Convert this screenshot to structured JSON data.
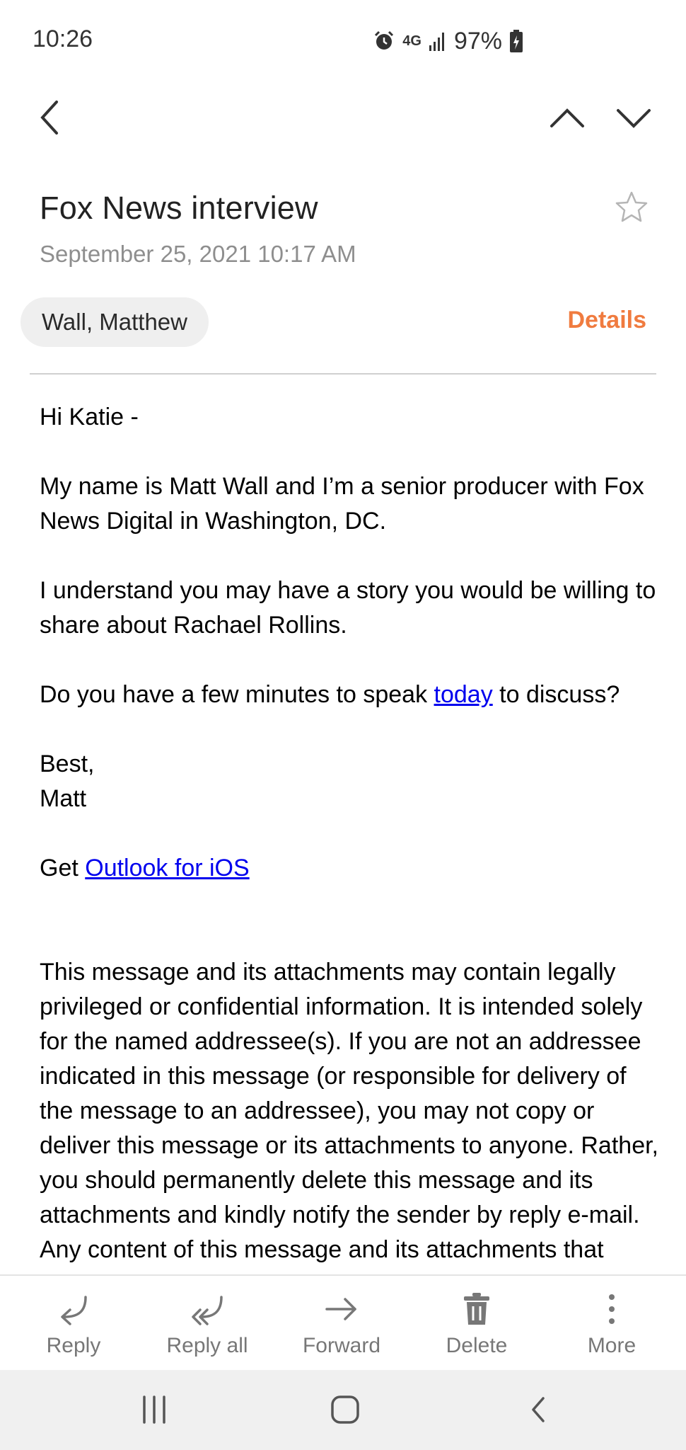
{
  "status_bar": {
    "time": "10:26",
    "network": "4G",
    "battery": "97%"
  },
  "icons": {
    "alarm": "alarm-icon",
    "signal": "signal-icon",
    "battery": "battery-charging-icon",
    "back": "chevron-left-icon",
    "prev": "chevron-up-icon",
    "next": "chevron-down-icon",
    "star": "star-outline-icon",
    "reply": "reply-icon",
    "reply_all": "reply-all-icon",
    "forward": "forward-icon",
    "delete": "trash-icon",
    "more": "more-vertical-icon"
  },
  "email": {
    "subject": "Fox News interview",
    "date": "September 25, 2021  10:17 AM",
    "sender": "Wall, Matthew",
    "details_label": "Details",
    "body": {
      "greeting": "Hi Katie -",
      "para1": "My name is Matt Wall and I’m a senior producer with Fox News Digital in Washington, DC.",
      "para2": "I understand you may have a story you would be willing to share about Rachael Rollins.",
      "para3_before": "Do you have a few minutes to speak ",
      "para3_link": "today",
      "para3_after": " to discuss?",
      "signoff": "Best,",
      "signature": "Matt",
      "get_prefix": "Get ",
      "get_link": "Outlook for iOS",
      "disclaimer": "This message and its attachments may contain legally privileged or confidential information. It is intended solely for the named addressee(s). If you are not an addressee indicated in this message (or responsible for delivery of the message to an addressee), you may not copy or deliver this message or its attachments to anyone. Rather, you should permanently delete this message and its attachments and kindly notify the sender by reply e-mail. Any content of this message and its attachments that does not relate to the official"
    }
  },
  "actions": {
    "reply": "Reply",
    "reply_all": "Reply all",
    "forward": "Forward",
    "delete": "Delete",
    "more": "More"
  },
  "system_nav": {
    "recents": "recents-icon",
    "home": "home-icon",
    "back": "back-icon"
  },
  "colors": {
    "accent": "#f07b3f",
    "link": "#0000ee",
    "muted": "#8e8e8e"
  }
}
